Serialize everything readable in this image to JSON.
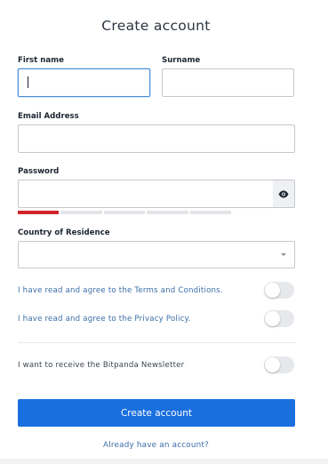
{
  "form": {
    "title": "Create account",
    "first_name": {
      "label": "First name",
      "value": ""
    },
    "surname": {
      "label": "Surname",
      "value": ""
    },
    "email": {
      "label": "Email Address",
      "value": ""
    },
    "password": {
      "label": "Password",
      "value": "",
      "strength_segments": 5,
      "strength_filled": 1,
      "strength_color": "#d1232a",
      "toggle_icon": "eye-icon"
    },
    "country": {
      "label": "Country of Residence",
      "value": ""
    },
    "terms": {
      "text": "I have read and agree to the Terms and Conditions.",
      "checked": false
    },
    "privacy": {
      "text": "I have read and agree to the Privacy Policy.",
      "checked": false
    },
    "newsletter": {
      "text": "I want to receive the Bitpanda Newsletter",
      "checked": false
    },
    "submit_label": "Create account",
    "login_link": "Already have an account?"
  },
  "colors": {
    "primary": "#1a6fdf",
    "link": "#3a6ea8",
    "focus": "#4a90d9"
  }
}
